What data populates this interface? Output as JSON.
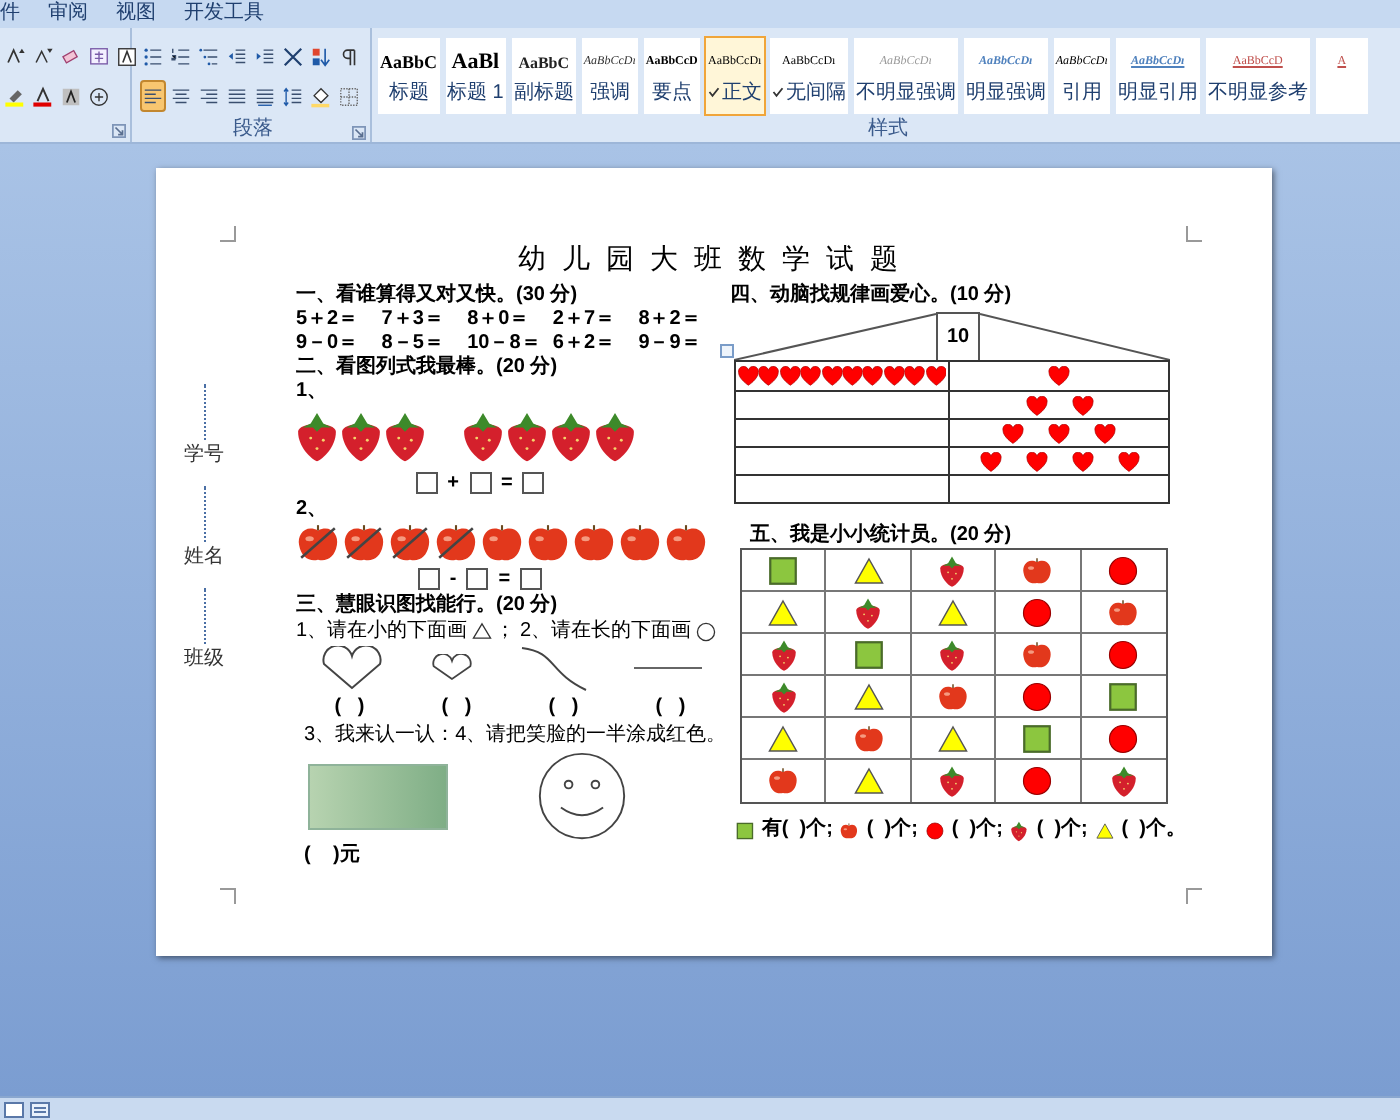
{
  "menu_tabs": [
    "件",
    "审阅",
    "视图",
    "开发工具"
  ],
  "ribbon": {
    "paragraph_label": "段落",
    "styles_label": "样式",
    "font_tools": [
      {
        "kind": "grow"
      },
      {
        "kind": "shrink"
      },
      {
        "kind": "eraser"
      },
      {
        "kind": "phonetic"
      },
      {
        "kind": "border"
      }
    ],
    "font_tools_2": [
      {
        "kind": "highlight"
      },
      {
        "kind": "color"
      },
      {
        "kind": "shading"
      },
      {
        "kind": "enclose"
      }
    ],
    "paragraph_tools": [
      {
        "kind": "bullets",
        "selected": false
      },
      {
        "kind": "numbering",
        "selected": false
      },
      {
        "kind": "multilevel",
        "selected": false
      },
      {
        "kind": "outdent",
        "selected": false
      },
      {
        "kind": "indent",
        "selected": false
      },
      {
        "kind": "cross",
        "selected": false
      },
      {
        "kind": "sort",
        "selected": false
      },
      {
        "kind": "marks",
        "selected": false
      }
    ],
    "paragraph_tools_2": [
      {
        "kind": "left",
        "selected": true
      },
      {
        "kind": "center",
        "selected": false
      },
      {
        "kind": "right",
        "selected": false
      },
      {
        "kind": "justify",
        "selected": false
      },
      {
        "kind": "distributed",
        "selected": false
      },
      {
        "kind": "spacing",
        "selected": false
      },
      {
        "kind": "bucket",
        "selected": false
      },
      {
        "kind": "borders",
        "selected": false
      }
    ],
    "styles": [
      {
        "preview": "AaBbC",
        "label": "标题",
        "kind": "heading",
        "selected": false,
        "checked": false
      },
      {
        "preview": "AaBl",
        "label": "标题 1",
        "kind": "title",
        "selected": false,
        "checked": false
      },
      {
        "preview": "AaBbC",
        "label": "副标题",
        "kind": "subtitle",
        "selected": false,
        "checked": false
      },
      {
        "preview": "AaBbCcDı",
        "label": "强调",
        "kind": "emphasis",
        "selected": false,
        "checked": false
      },
      {
        "preview": "AaBbCcD",
        "label": "要点",
        "kind": "strong",
        "selected": false,
        "checked": false
      },
      {
        "preview": "AaBbCcDı",
        "label": "正文",
        "kind": "normal",
        "selected": true,
        "checked": true
      },
      {
        "preview": "AaBbCcDı",
        "label": "无间隔",
        "kind": "normal",
        "selected": false,
        "checked": true
      },
      {
        "preview": "AaBbCcDı",
        "label": "不明显强调",
        "kind": "subtle",
        "selected": false,
        "checked": false
      },
      {
        "preview": "AaBbCcDı",
        "label": "明显强调",
        "kind": "intense",
        "selected": false,
        "checked": false
      },
      {
        "preview": "AaBbCcDı",
        "label": "引用",
        "kind": "quote",
        "selected": false,
        "checked": false
      },
      {
        "preview": "AaBbCcDı",
        "label": "明显引用",
        "kind": "intense-quote",
        "selected": false,
        "checked": false
      },
      {
        "preview": "AaBbCcD",
        "label": "不明显参考",
        "kind": "reference",
        "selected": false,
        "checked": false
      },
      {
        "preview": "A",
        "kind": "reference",
        "selected": false,
        "checked": false
      }
    ]
  },
  "document": {
    "side_labels": [
      "学号",
      "姓名",
      "班级"
    ],
    "title": "幼儿园大班数学试题",
    "section1": {
      "heading": "一、看谁算得又对又快。(30 分)",
      "rows": [
        [
          "5＋2＝",
          "7＋3＝",
          "8＋0＝",
          "2＋7＝",
          "8＋2＝"
        ],
        [
          "9－0＝",
          "8－5＝",
          "10－8＝",
          "6＋2＝",
          "9－9＝"
        ]
      ]
    },
    "section2": {
      "heading": "二、看图列式我最棒。(20 分)",
      "problems": [
        {
          "number": "1、",
          "groups": [
            [
              {
                "kind": "strawberry",
                "crossed": false
              },
              {
                "kind": "strawberry",
                "crossed": false
              },
              {
                "kind": "strawberry",
                "crossed": false
              }
            ],
            [
              {
                "kind": "strawberry",
                "crossed": false
              },
              {
                "kind": "strawberry",
                "crossed": false
              },
              {
                "kind": "strawberry",
                "crossed": false
              },
              {
                "kind": "strawberry",
                "crossed": false
              }
            ]
          ],
          "operators": [
            "+",
            "="
          ]
        },
        {
          "number": "2、",
          "groups": [
            [
              {
                "kind": "apple",
                "crossed": true
              },
              {
                "kind": "apple",
                "crossed": true
              },
              {
                "kind": "apple",
                "crossed": true
              },
              {
                "kind": "apple",
                "crossed": true
              },
              {
                "kind": "apple",
                "crossed": false
              },
              {
                "kind": "apple",
                "crossed": false
              },
              {
                "kind": "apple",
                "crossed": false
              },
              {
                "kind": "apple",
                "crossed": false
              },
              {
                "kind": "apple",
                "crossed": false
              }
            ]
          ],
          "operators": [
            "-",
            "="
          ]
        }
      ]
    },
    "section3": {
      "heading": "三、慧眼识图找能行。(20 分)",
      "task1": {
        "text": "1、请在小的下面画",
        "symbol": {
          "kind": "triangle"
        },
        "after": "；"
      },
      "task2": {
        "text": "2、请在长的下面画",
        "symbol": {
          "kind": "circle"
        }
      },
      "shapes": [
        {
          "kind": "big-heart"
        },
        {
          "kind": "small-heart"
        },
        {
          "kind": "curve"
        },
        {
          "kind": "line"
        }
      ],
      "answers": [
        "(   )",
        "(   )",
        "(   )",
        "(   )"
      ],
      "task3": "3、我来认一认：",
      "task4": "4、请把笑脸的一半涂成红色。",
      "money_answer": "(    )元"
    },
    "section4": {
      "heading": "四、动脑找规律画爱心。(10 分)",
      "roof_label": "10",
      "rows": [
        {
          "left": [
            {
              "kind": "heart"
            },
            {
              "kind": "heart"
            },
            {
              "kind": "heart"
            },
            {
              "kind": "heart"
            },
            {
              "kind": "heart"
            },
            {
              "kind": "heart"
            },
            {
              "kind": "heart"
            },
            {
              "kind": "heart"
            },
            {
              "kind": "heart"
            },
            {
              "kind": "heart"
            }
          ],
          "right": [
            {
              "kind": "heart"
            }
          ]
        },
        {
          "right": [
            {
              "kind": "heart"
            },
            {
              "kind": "heart"
            }
          ]
        },
        {
          "right": [
            {
              "kind": "heart"
            },
            {
              "kind": "heart"
            },
            {
              "kind": "heart"
            }
          ]
        },
        {
          "right": [
            {
              "kind": "heart"
            },
            {
              "kind": "heart"
            },
            {
              "kind": "heart"
            },
            {
              "kind": "heart"
            }
          ]
        },
        {}
      ]
    },
    "section5": {
      "heading": "五、我是小小统计员。(20 分)",
      "grid": [
        [
          {
            "kind": "square"
          },
          {
            "kind": "triangle"
          },
          {
            "kind": "strawberry"
          },
          {
            "kind": "apple"
          },
          {
            "kind": "circle"
          }
        ],
        [
          {
            "kind": "triangle"
          },
          {
            "kind": "strawberry"
          },
          {
            "kind": "triangle"
          },
          {
            "kind": "circle"
          },
          {
            "kind": "apple"
          }
        ],
        [
          {
            "kind": "strawberry"
          },
          {
            "kind": "square"
          },
          {
            "kind": "strawberry"
          },
          {
            "kind": "apple"
          },
          {
            "kind": "circle"
          }
        ],
        [
          {
            "kind": "strawberry"
          },
          {
            "kind": "triangle"
          },
          {
            "kind": "apple"
          },
          {
            "kind": "circle"
          },
          {
            "kind": "square"
          }
        ],
        [
          {
            "kind": "triangle"
          },
          {
            "kind": "apple"
          },
          {
            "kind": "triangle"
          },
          {
            "kind": "square"
          },
          {
            "kind": "circle"
          }
        ],
        [
          {
            "kind": "apple"
          },
          {
            "kind": "triangle"
          },
          {
            "kind": "strawberry"
          },
          {
            "kind": "circle"
          },
          {
            "kind": "strawberry"
          }
        ]
      ],
      "legend": [
        {
          "kind": "square",
          "text": "有(  )个;"
        },
        {
          "kind": "apple",
          "text": "(  )个;"
        },
        {
          "kind": "circle",
          "text": "(  )个;"
        },
        {
          "kind": "strawberry",
          "text": "(  )个;"
        },
        {
          "kind": "triangle",
          "text": "(  )个。"
        }
      ]
    }
  }
}
